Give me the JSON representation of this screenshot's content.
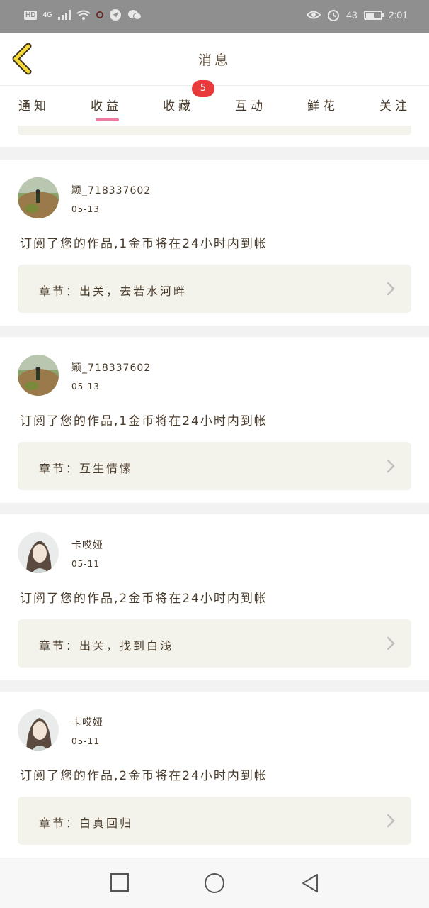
{
  "status_bar": {
    "hd": "HD",
    "network": "4G",
    "time": "2:01",
    "battery_level": 0.6,
    "battery_text": "43",
    "icons": [
      "hd-icon",
      "signal-icon",
      "wifi-icon",
      "record-icon",
      "location-icon",
      "wechat-icon",
      "eye-icon",
      "alarm-icon",
      "battery-icon"
    ]
  },
  "header": {
    "title": "消息",
    "back_icon": "chevron-left-icon"
  },
  "tabs": [
    {
      "label": "通知",
      "active": false
    },
    {
      "label": "收益",
      "active": true
    },
    {
      "label": "收藏",
      "active": false,
      "badge": "5"
    },
    {
      "label": "互动",
      "active": false
    },
    {
      "label": "鲜花",
      "active": false
    },
    {
      "label": "关注",
      "active": false
    }
  ],
  "messages": [
    {
      "user": "颖_718337602",
      "date": "05-13",
      "text": "订阅了您的作品,1金币将在24小时内到帐",
      "chapter": "章节：出关，去若水河畔"
    },
    {
      "user": "颖_718337602",
      "date": "05-13",
      "text": "订阅了您的作品,1金币将在24小时内到帐",
      "chapter": "章节：互生情愫"
    },
    {
      "user": "卡哎娅",
      "date": "05-11",
      "text": "订阅了您的作品,2金币将在24小时内到帐",
      "chapter": "章节：出关，找到白浅"
    },
    {
      "user": "卡哎娅",
      "date": "05-11",
      "text": "订阅了您的作品,2金币将在24小时内到帐",
      "chapter": "章节：白真回归"
    }
  ],
  "nav": [
    "square-icon",
    "circle-icon",
    "triangle-back-icon"
  ],
  "colors": {
    "accent": "#ee7aa1",
    "badge": "#e83a3a",
    "chip_bg": "#f4f3eb",
    "back_arrow": "#f5d93a"
  }
}
